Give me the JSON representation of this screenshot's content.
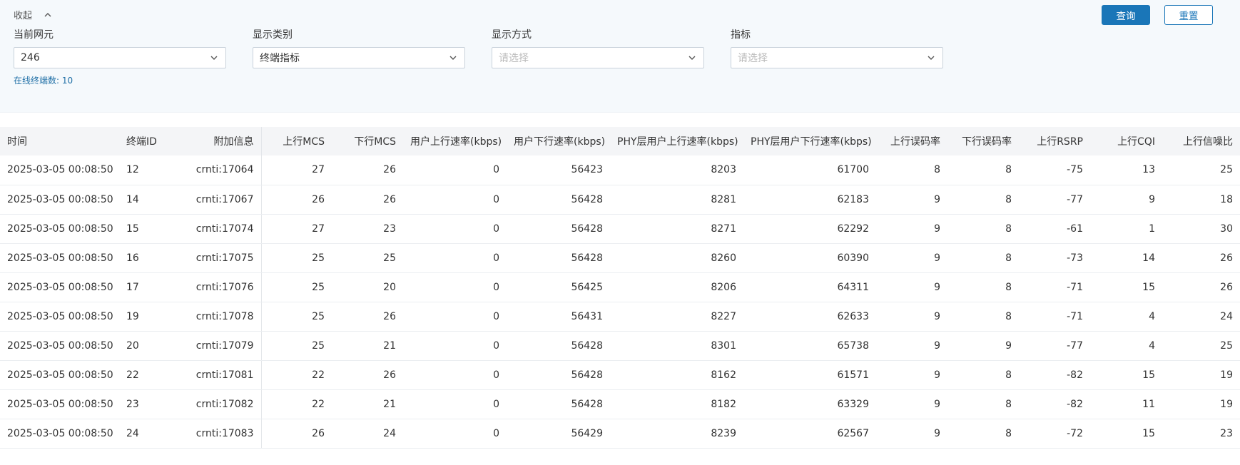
{
  "filters": {
    "collapse_label": "收起",
    "network_element": {
      "label": "当前网元",
      "value": "246"
    },
    "display_category": {
      "label": "显示类别",
      "value": "终端指标"
    },
    "display_mode": {
      "label": "显示方式",
      "placeholder": "请选择"
    },
    "metric": {
      "label": "指标",
      "placeholder": "请选择"
    },
    "online_terminals": "在线终端数: 10",
    "query_button": "查询",
    "reset_button": "重置"
  },
  "table": {
    "headers": [
      "时间",
      "终端ID",
      "附加信息",
      "上行MCS",
      "下行MCS",
      "用户上行速率(kbps)",
      "用户下行速率(kbps)",
      "PHY层用户上行速率(kbps)",
      "PHY层用户下行速率(kbps)",
      "上行误码率",
      "下行误码率",
      "上行RSRP",
      "上行CQI",
      "上行信噪比"
    ],
    "rows": [
      [
        "2025-03-05 00:08:50",
        "12",
        "crnti:17064",
        "27",
        "26",
        "0",
        "56423",
        "8203",
        "61700",
        "8",
        "8",
        "-75",
        "13",
        "25"
      ],
      [
        "2025-03-05 00:08:50",
        "14",
        "crnti:17067",
        "26",
        "26",
        "0",
        "56428",
        "8281",
        "62183",
        "9",
        "8",
        "-77",
        "9",
        "18"
      ],
      [
        "2025-03-05 00:08:50",
        "15",
        "crnti:17074",
        "27",
        "23",
        "0",
        "56428",
        "8271",
        "62292",
        "9",
        "8",
        "-61",
        "1",
        "30"
      ],
      [
        "2025-03-05 00:08:50",
        "16",
        "crnti:17075",
        "25",
        "25",
        "0",
        "56428",
        "8260",
        "60390",
        "9",
        "8",
        "-73",
        "14",
        "26"
      ],
      [
        "2025-03-05 00:08:50",
        "17",
        "crnti:17076",
        "25",
        "20",
        "0",
        "56425",
        "8206",
        "64311",
        "9",
        "8",
        "-71",
        "15",
        "26"
      ],
      [
        "2025-03-05 00:08:50",
        "19",
        "crnti:17078",
        "25",
        "26",
        "0",
        "56431",
        "8227",
        "62633",
        "9",
        "8",
        "-71",
        "4",
        "24"
      ],
      [
        "2025-03-05 00:08:50",
        "20",
        "crnti:17079",
        "25",
        "21",
        "0",
        "56428",
        "8301",
        "65738",
        "9",
        "9",
        "-77",
        "4",
        "25"
      ],
      [
        "2025-03-05 00:08:50",
        "22",
        "crnti:17081",
        "22",
        "26",
        "0",
        "56428",
        "8162",
        "61571",
        "9",
        "8",
        "-82",
        "15",
        "19"
      ],
      [
        "2025-03-05 00:08:50",
        "23",
        "crnti:17082",
        "22",
        "21",
        "0",
        "56428",
        "8182",
        "63329",
        "9",
        "8",
        "-82",
        "11",
        "19"
      ],
      [
        "2025-03-05 00:08:50",
        "24",
        "crnti:17083",
        "26",
        "24",
        "0",
        "56429",
        "8239",
        "62567",
        "9",
        "8",
        "-72",
        "15",
        "23"
      ]
    ]
  }
}
